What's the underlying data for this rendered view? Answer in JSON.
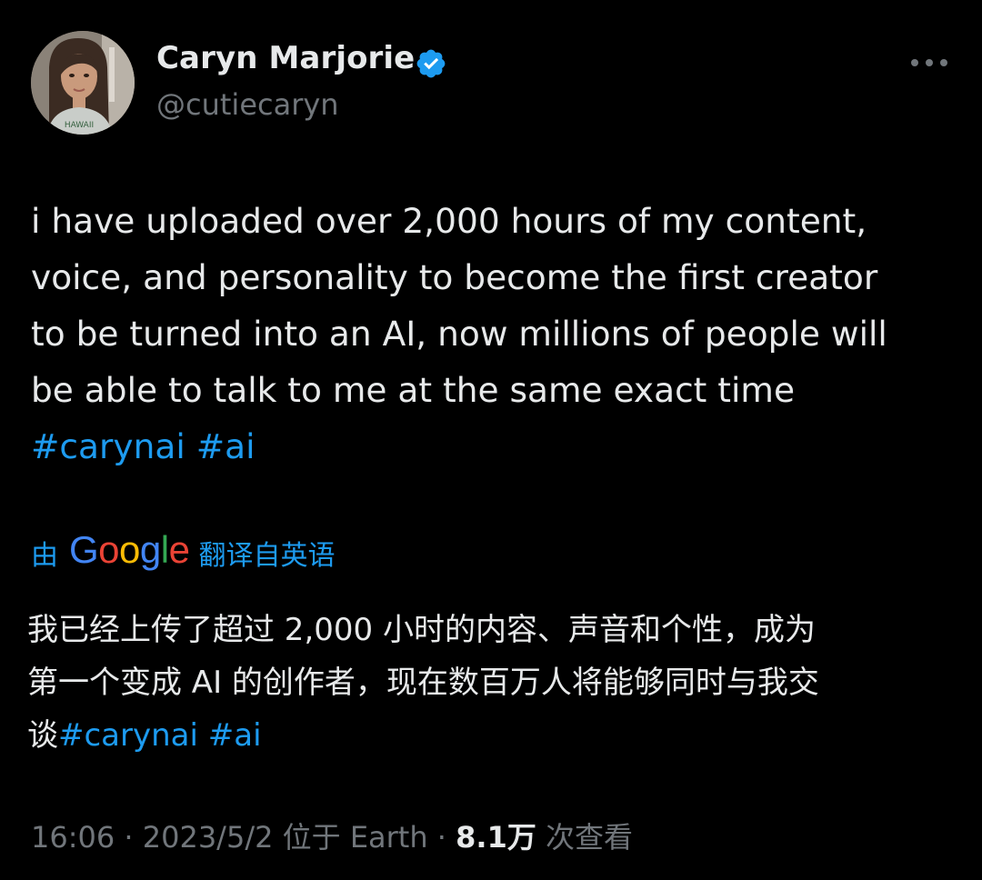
{
  "author": {
    "name": "Caryn Marjorie",
    "handle": "@cutiecaryn",
    "verified": true,
    "avatar_shirt_text": "HAWAII"
  },
  "tweet": {
    "lines": [
      "i have uploaded over 2,000 hours of my content,",
      "voice, and personality to become the first creator",
      "to be turned into an AI, now millions of people will",
      "be able to talk to me at the same exact time"
    ],
    "hashtags": [
      "#carynai",
      "#ai"
    ]
  },
  "translation": {
    "prefix": "由",
    "provider": "Google",
    "suffix": "翻译自英语",
    "lines": [
      "我已经上传了超过 2,000 小时的内容、声音和个性，成为",
      "第一个变成 AI 的创作者，现在数百万人将能够同时与我交"
    ],
    "last_line_prefix": "谈",
    "hashtags": [
      "#carynai",
      "#ai"
    ]
  },
  "meta": {
    "time": "16:06",
    "sep1": "·",
    "date": "2023/5/2",
    "location_prefix": "位于",
    "location": "Earth",
    "sep2": "·",
    "views": "8.1万",
    "views_label": "次查看"
  },
  "colors": {
    "background": "#000000",
    "text": "#e7e9ea",
    "secondary": "#71767b",
    "accent": "#1d9bf0"
  },
  "icons": {
    "verified": "verified-badge-icon",
    "more": "more-horizontal-icon"
  }
}
